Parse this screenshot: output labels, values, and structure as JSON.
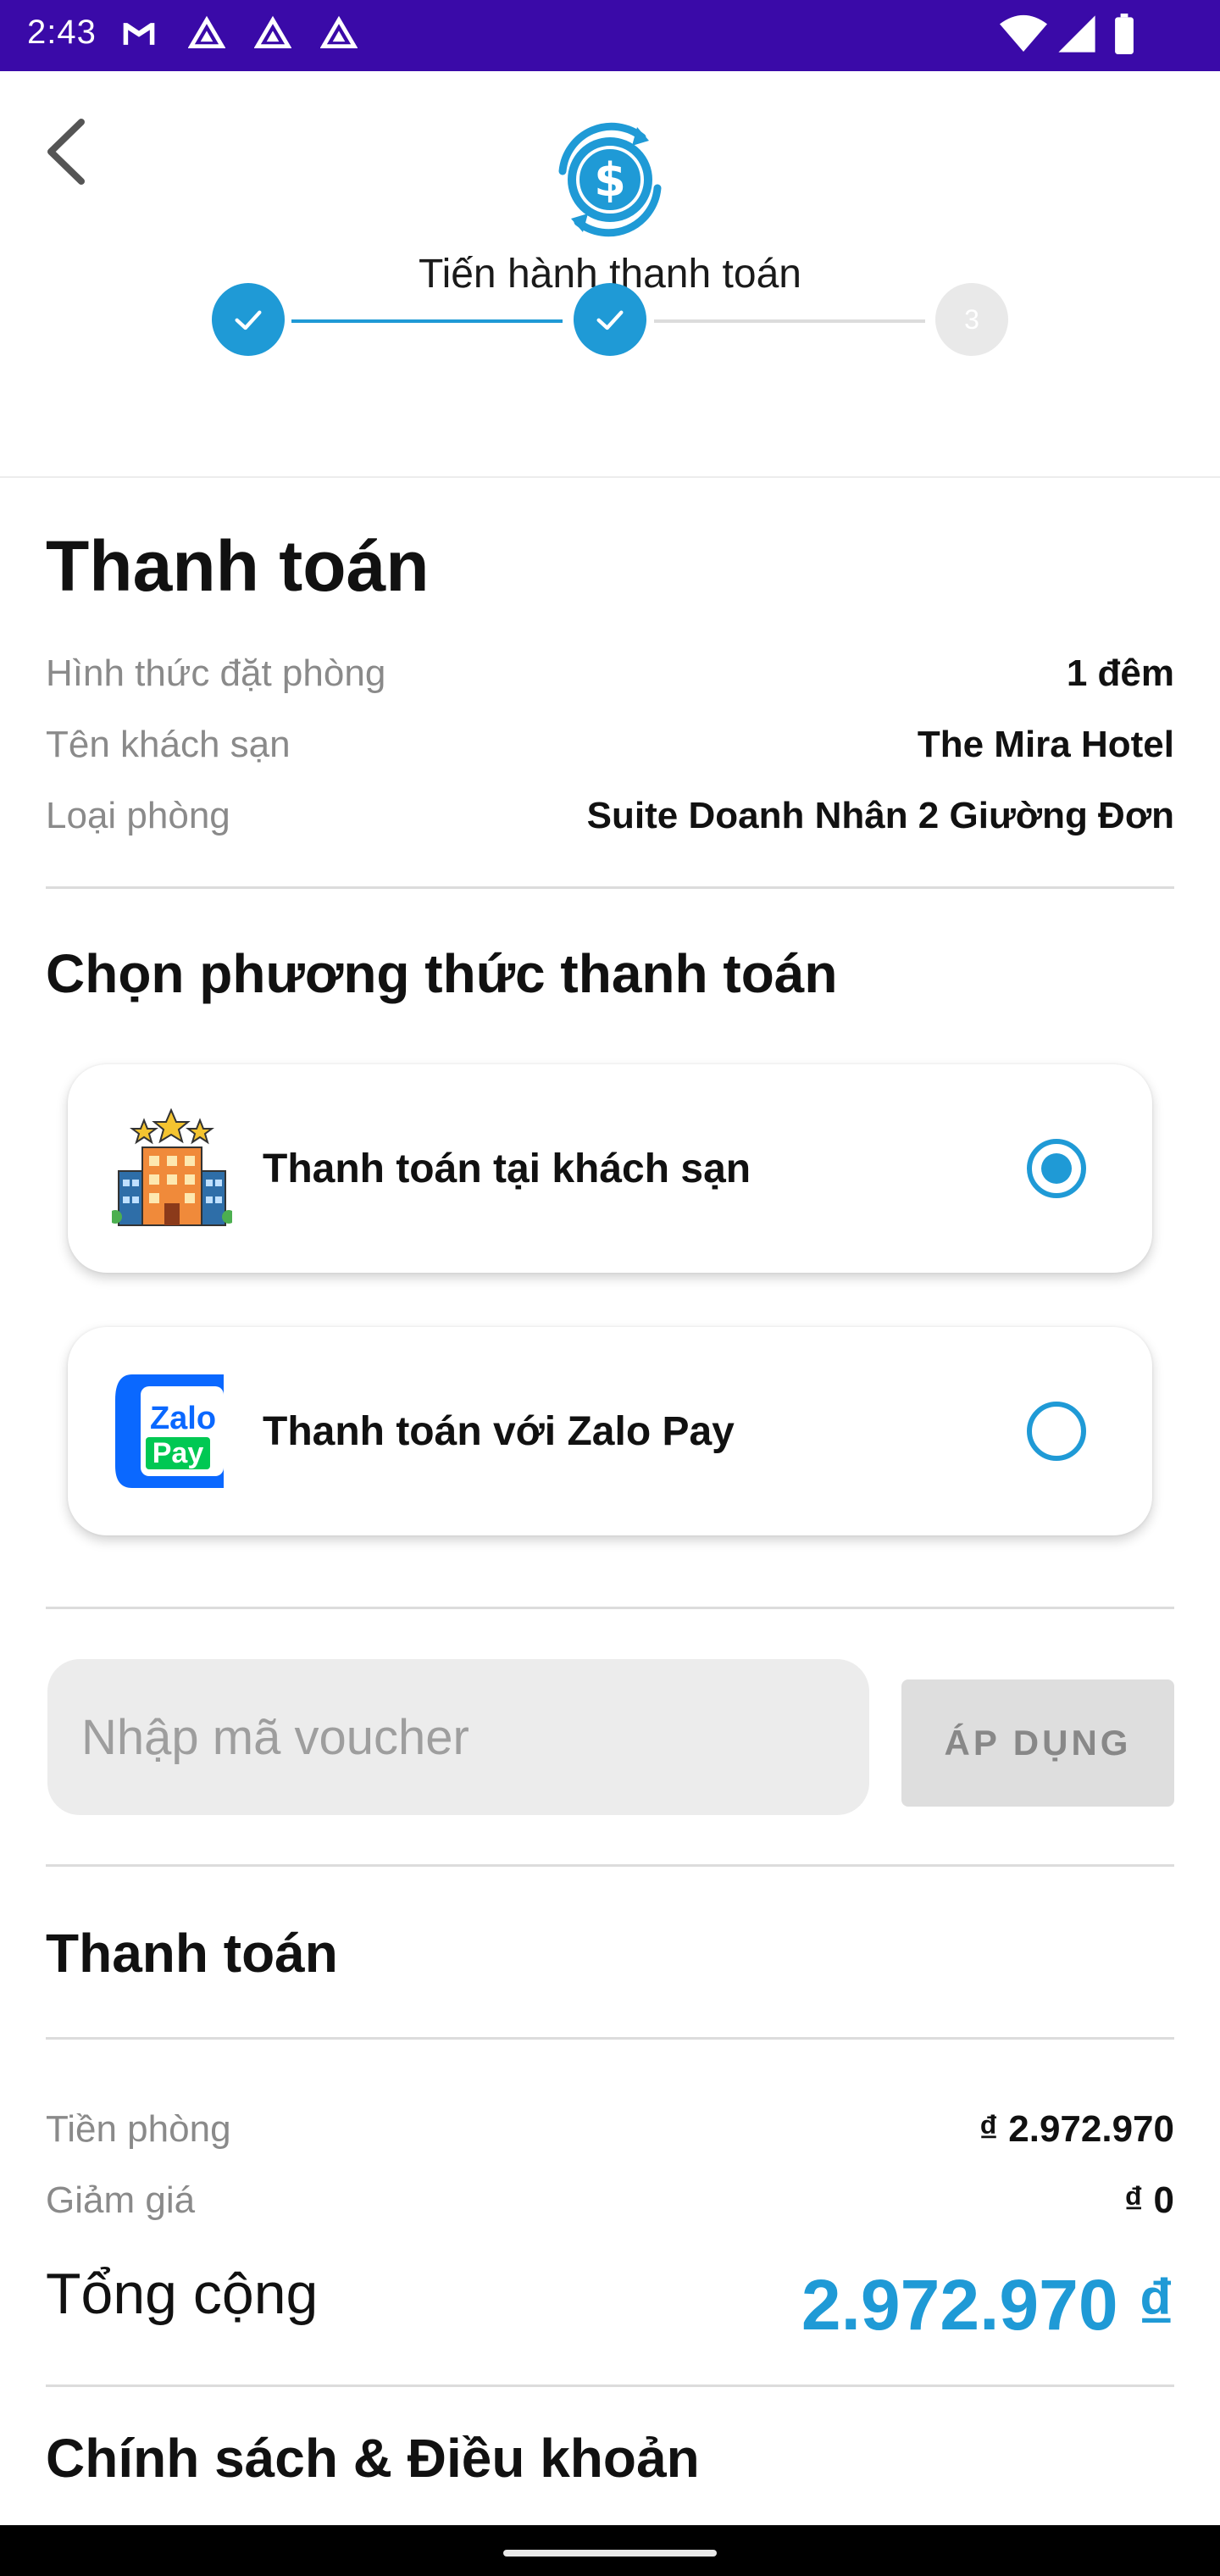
{
  "status_bar": {
    "time": "2:43",
    "notification_icons": [
      "gmail-icon",
      "drive-icon",
      "drive-icon",
      "drive-icon"
    ],
    "system_icons": [
      "wifi-icon",
      "signal-icon",
      "battery-icon"
    ]
  },
  "header": {
    "title": "Tiến hành thanh toán",
    "steps": [
      {
        "state": "done"
      },
      {
        "state": "done"
      },
      {
        "state": "pending",
        "label": "3"
      }
    ]
  },
  "booking": {
    "title": "Thanh toán",
    "rows": [
      {
        "label": "Hình thức đặt phòng",
        "value": "1 đêm"
      },
      {
        "label": "Tên khách sạn",
        "value": "The Mira Hotel"
      },
      {
        "label": "Loại phòng",
        "value": "Suite Doanh Nhân 2 Giường Đơn"
      }
    ]
  },
  "payment_method": {
    "title": "Chọn phương thức thanh toán",
    "options": [
      {
        "label": "Thanh toán tại khách sạn",
        "icon": "hotel-icon",
        "selected": true
      },
      {
        "label": "Thanh toán với Zalo Pay",
        "icon": "zalopay-icon",
        "selected": false,
        "logo_text": [
          "Zalo",
          "Pay"
        ]
      }
    ]
  },
  "voucher": {
    "placeholder": "Nhập mã voucher",
    "apply_label": "ÁP DỤNG"
  },
  "summary": {
    "title": "Thanh toán",
    "rows": [
      {
        "label": "Tiền phòng",
        "value": "₫ 2.972.970"
      },
      {
        "label": "Giảm giá",
        "value": "₫ 0"
      }
    ],
    "total_label": "Tổng cộng",
    "total_value": "2.972.970 ₫"
  },
  "policy": {
    "title": "Chính sách & Điều khoản"
  },
  "colors": {
    "status_bar": "#3a0aa8",
    "accent": "#1f9ad6",
    "muted_text": "#8a8a8a"
  }
}
